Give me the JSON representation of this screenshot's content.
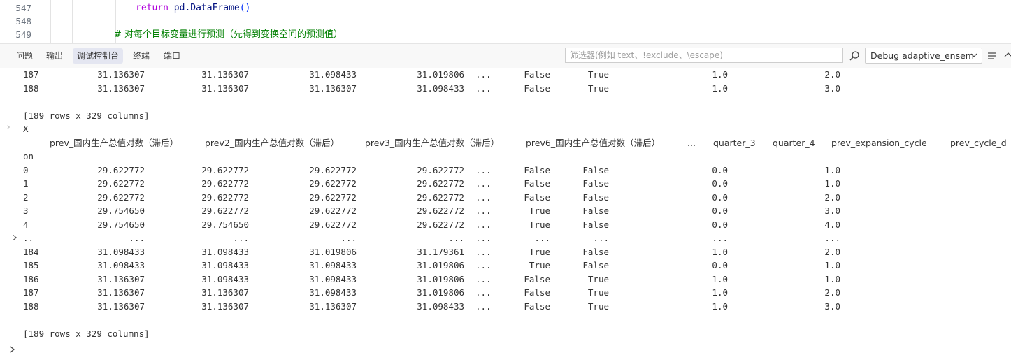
{
  "editor": {
    "lines": [
      {
        "no": "547",
        "parts": [
          {
            "t": "return",
            "cls": "kw-return"
          },
          {
            "t": " pd.",
            "cls": "kw-fn"
          },
          {
            "t": "DataFrame",
            "cls": "kw-fn"
          },
          {
            "t": "()",
            "cls": "punct"
          }
        ]
      },
      {
        "no": "548",
        "parts": []
      },
      {
        "no": "549",
        "parts": [
          {
            "t": "# 对每个目标变量进行预测（先得到变换空间的预测值）",
            "cls": "comment"
          }
        ]
      }
    ]
  },
  "panel": {
    "tabs": [
      "问题",
      "输出",
      "调试控制台",
      "终端",
      "端口"
    ],
    "active_tab": "调试控制台",
    "filter_placeholder": "筛选器(例如 text、!exclude、\\escape)",
    "session": "Debug adaptive_ensem"
  },
  "console": {
    "top_rows": [
      [
        "187",
        "31.136307",
        "31.136307",
        "31.098433",
        "31.019806",
        "...",
        "False",
        "True",
        "1.0",
        "2.0"
      ],
      [
        "188",
        "31.136307",
        "31.136307",
        "31.136307",
        "31.098433",
        "...",
        "False",
        "True",
        "1.0",
        "3.0"
      ]
    ],
    "summary1": "[189 rows x 329 columns]",
    "var_name": "X",
    "headers": [
      "prev_国内生产总值对数（滞后）",
      "prev2_国内生产总值对数（滞后）",
      "prev3_国内生产总值对数（滞后）",
      "prev6_国内生产总值对数（滞后）",
      "...",
      "quarter_3",
      "quarter_4",
      "prev_expansion_cycle",
      "prev_cycle_d"
    ],
    "index_label": "on",
    "rows": [
      [
        "0",
        "29.622772",
        "29.622772",
        "29.622772",
        "29.622772",
        "...",
        "False",
        "False",
        "0.0",
        "1.0"
      ],
      [
        "1",
        "29.622772",
        "29.622772",
        "29.622772",
        "29.622772",
        "...",
        "False",
        "False",
        "0.0",
        "1.0"
      ],
      [
        "2",
        "29.622772",
        "29.622772",
        "29.622772",
        "29.622772",
        "...",
        "False",
        "False",
        "0.0",
        "2.0"
      ],
      [
        "3",
        "29.754650",
        "29.622772",
        "29.622772",
        "29.622772",
        "...",
        "True",
        "False",
        "0.0",
        "3.0"
      ],
      [
        "4",
        "29.754650",
        "29.754650",
        "29.622772",
        "29.622772",
        "...",
        "True",
        "False",
        "0.0",
        "4.0"
      ],
      [
        "..",
        "...",
        "...",
        "...",
        "...",
        "...",
        "...",
        "...",
        "...",
        "..."
      ],
      [
        "184",
        "31.098433",
        "31.098433",
        "31.019806",
        "31.179361",
        "...",
        "True",
        "False",
        "1.0",
        "2.0"
      ],
      [
        "185",
        "31.098433",
        "31.098433",
        "31.098433",
        "31.019806",
        "...",
        "True",
        "False",
        "0.0",
        "1.0"
      ],
      [
        "186",
        "31.136307",
        "31.098433",
        "31.098433",
        "31.019806",
        "...",
        "False",
        "True",
        "1.0",
        "1.0"
      ],
      [
        "187",
        "31.136307",
        "31.136307",
        "31.098433",
        "31.019806",
        "...",
        "False",
        "True",
        "1.0",
        "2.0"
      ],
      [
        "188",
        "31.136307",
        "31.136307",
        "31.136307",
        "31.098433",
        "...",
        "False",
        "True",
        "1.0",
        "3.0"
      ]
    ],
    "summary2": "[189 rows x 329 columns]"
  }
}
